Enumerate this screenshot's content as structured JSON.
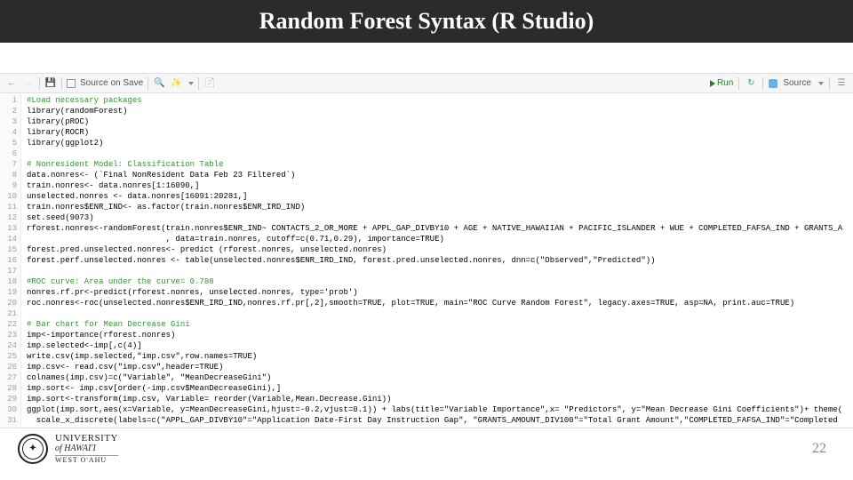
{
  "slide": {
    "title": "Random Forest Syntax (R Studio)",
    "page_number": "22"
  },
  "toolbar": {
    "source_on_save": "Source on Save",
    "run": "Run",
    "source": "Source"
  },
  "university": {
    "line1": "UNIVERSITY",
    "line2": "of HAWAI'I",
    "line3": "WEST O'AHU"
  },
  "code": {
    "lines": [
      {
        "n": 1,
        "cls": "c-comment",
        "t": "#Load necessary packages"
      },
      {
        "n": 2,
        "cls": "",
        "t": "library(randomForest)"
      },
      {
        "n": 3,
        "cls": "",
        "t": "library(pROC)"
      },
      {
        "n": 4,
        "cls": "",
        "t": "library(ROCR)"
      },
      {
        "n": 5,
        "cls": "",
        "t": "library(ggplot2)"
      },
      {
        "n": 6,
        "cls": "",
        "t": ""
      },
      {
        "n": 7,
        "cls": "c-comment",
        "t": "# Nonresident Model: Classification Table"
      },
      {
        "n": 8,
        "cls": "",
        "t": "data.nonres<- (`Final NonResident Data Feb 23 Filtered`)"
      },
      {
        "n": 9,
        "cls": "",
        "t": "train.nonres<- data.nonres[1:16090,]"
      },
      {
        "n": 10,
        "cls": "",
        "t": "unselected.nonres <- data.nonres[16091:20281,]"
      },
      {
        "n": 11,
        "cls": "",
        "t": "train.nonres$ENR_IND<- as.factor(train.nonres$ENR_IRD_IND)"
      },
      {
        "n": 12,
        "cls": "",
        "t": "set.seed(9073)"
      },
      {
        "n": 13,
        "cls": "",
        "t": "rforest.nonres<-randomForest(train.nonres$ENR_IND~ CONTACTS_2_OR_MORE + APPL_GAP_DIVBY10 + AGE + NATIVE_HAWAIIAN + PACIFIC_ISLANDER + WUE + COMPLETED_FAFSA_IND + GRANTS_A"
      },
      {
        "n": 14,
        "cls": "",
        "t": "                             , data=train.nonres, cutoff=c(0.71,0.29), importance=TRUE)"
      },
      {
        "n": 15,
        "cls": "",
        "t": "forest.pred.unselected.nonres<- predict (rforest.nonres, unselected.nonres)"
      },
      {
        "n": 16,
        "cls": "",
        "t": "forest.perf.unselected.nonres <- table(unselected.nonres$ENR_IRD_IND, forest.pred.unselected.nonres, dnn=c(\"Observed\",\"Predicted\"))"
      },
      {
        "n": 17,
        "cls": "",
        "t": ""
      },
      {
        "n": 18,
        "cls": "c-comment",
        "t": "#ROC curve: Area under the curve= 0.788"
      },
      {
        "n": 19,
        "cls": "",
        "t": "nonres.rf.pr<-predict(rforest.nonres, unselected.nonres, type='prob')"
      },
      {
        "n": 20,
        "cls": "",
        "t": "roc.nonres<-roc(unselected.nonres$ENR_IRD_IND,nonres.rf.pr[,2],smooth=TRUE, plot=TRUE, main=\"ROC Curve Random Forest\", legacy.axes=TRUE, asp=NA, print.auc=TRUE)"
      },
      {
        "n": 21,
        "cls": "",
        "t": ""
      },
      {
        "n": 22,
        "cls": "c-comment",
        "t": "# Bar chart for Mean Decrease Gini"
      },
      {
        "n": 23,
        "cls": "",
        "t": "imp<-importance(rforest.nonres)"
      },
      {
        "n": 24,
        "cls": "",
        "t": "imp.selected<-imp[,c(4)]"
      },
      {
        "n": 25,
        "cls": "",
        "t": "write.csv(imp.selected,\"imp.csv\",row.names=TRUE)"
      },
      {
        "n": 26,
        "cls": "",
        "t": "imp.csv<- read.csv(\"imp.csv\",header=TRUE)"
      },
      {
        "n": 27,
        "cls": "",
        "t": "colnames(imp.csv)=c(\"Variable\", \"MeanDecreaseGini\")"
      },
      {
        "n": 28,
        "cls": "",
        "t": "imp.sort<- imp.csv[order(-imp.csv$MeanDecreaseGini),]"
      },
      {
        "n": 29,
        "cls": "",
        "t": "imp.sort<-transform(imp.csv, Variable= reorder(Variable,Mean.Decrease.Gini))"
      },
      {
        "n": 30,
        "cls": "",
        "t": "ggplot(imp.sort,aes(x=Variable, y=MeanDecreaseGini,hjust=-0.2,vjust=0.1)) + labs(title=\"Variable Importance\",x= \"Predictors\", y=\"Mean Decrease Gini Coefficients\")+ theme("
      },
      {
        "n": 31,
        "cls": "",
        "t": "  scale_x_discrete(labels=c(\"APPL_GAP_DIVBY10\"=\"Application Date-First Day Instruction Gap\", \"GRANTS_AMOUNT_DIV100\"=\"Total Grant Amount\",\"COMPLETED_FAFSA_IND\"=\"Completed"
      }
    ]
  }
}
